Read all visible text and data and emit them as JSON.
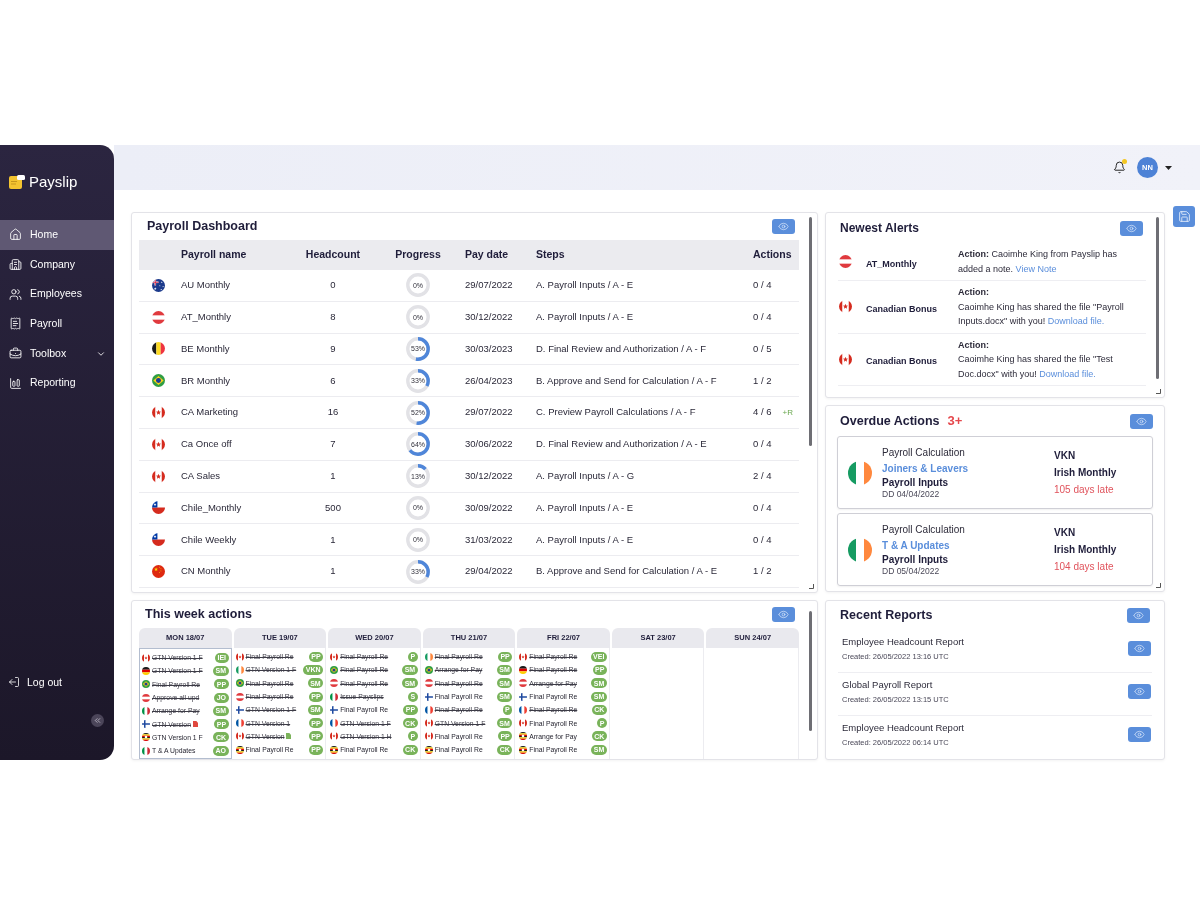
{
  "sidebar": {
    "logo": "Payslip",
    "items": [
      {
        "label": "Home",
        "selected": true,
        "kind": "link"
      },
      {
        "label": "Company",
        "selected": false,
        "kind": "link"
      },
      {
        "label": "Employees",
        "selected": false,
        "kind": "link"
      },
      {
        "label": "Payroll",
        "selected": false,
        "kind": "link"
      },
      {
        "label": "Toolbox",
        "selected": false,
        "kind": "group"
      },
      {
        "label": "Reporting",
        "selected": false,
        "kind": "link"
      }
    ],
    "logout": "Log out"
  },
  "header": {
    "notifications": {
      "unread": true
    },
    "user": {
      "initials": "NN"
    }
  },
  "payroll_dashboard": {
    "title": "Payroll Dashboard",
    "columns": [
      "Payroll name",
      "Headcount",
      "Progress",
      "Pay date",
      "Steps",
      "Actions"
    ],
    "rows": [
      {
        "flag": {
          "kind": "au"
        },
        "name": "AU Monthly",
        "headcount": "0",
        "progress": {
          "level": 0,
          "reading": "0%"
        },
        "pay_date": "29/07/2022",
        "steps": "A. Payroll Inputs / A - E",
        "actions": "0 / 4"
      },
      {
        "flag": {
          "kind": "at"
        },
        "name": "AT_Monthly",
        "headcount": "8",
        "progress": {
          "level": 0,
          "reading": "0%"
        },
        "pay_date": "30/12/2022",
        "steps": "A. Payroll Inputs / A - E",
        "actions": "0 / 4"
      },
      {
        "flag": {
          "kind": "be"
        },
        "name": "BE Monthly",
        "headcount": "9",
        "progress": {
          "level": 0.53,
          "reading": "53%"
        },
        "pay_date": "30/03/2023",
        "steps": "D. Final Review and Authorization / A - F",
        "actions": "0 / 5"
      },
      {
        "flag": {
          "kind": "br"
        },
        "name": "BR Monthly",
        "headcount": "6",
        "progress": {
          "level": 0.33,
          "reading": "33%"
        },
        "pay_date": "26/04/2023",
        "steps": "B. Approve and Send for Calculation / A - F",
        "actions": "1 / 2"
      },
      {
        "flag": {
          "kind": "ca"
        },
        "name": "CA Marketing",
        "headcount": "16",
        "progress": {
          "level": 0.52,
          "reading": "52%"
        },
        "pay_date": "29/07/2022",
        "steps": "C. Preview Payroll Calculations / A - F",
        "actions": "4 / 6",
        "note": "+R"
      },
      {
        "flag": {
          "kind": "ca"
        },
        "name": "Ca Once off",
        "headcount": "7",
        "progress": {
          "level": 0.64,
          "reading": "64%"
        },
        "pay_date": "30/06/2022",
        "steps": "D. Final Review and Authorization / A - E",
        "actions": "0 / 4"
      },
      {
        "flag": {
          "kind": "ca"
        },
        "name": "CA Sales",
        "headcount": "1",
        "progress": {
          "level": 0.13,
          "reading": "13%"
        },
        "pay_date": "30/12/2022",
        "steps": "A. Payroll Inputs / A - G",
        "actions": "2 / 4"
      },
      {
        "flag": {
          "kind": "cl"
        },
        "name": "Chile_Monthly",
        "headcount": "500",
        "progress": {
          "level": 0,
          "reading": "0%"
        },
        "pay_date": "30/09/2022",
        "steps": "A. Payroll Inputs / A - E",
        "actions": "0 / 4"
      },
      {
        "flag": {
          "kind": "cl"
        },
        "name": "Chile Weekly",
        "headcount": "1",
        "progress": {
          "level": 0,
          "reading": "0%"
        },
        "pay_date": "31/03/2022",
        "steps": "A. Payroll Inputs / A - E",
        "actions": "0 / 4"
      },
      {
        "flag": {
          "kind": "cn"
        },
        "name": "CN Monthly",
        "headcount": "1",
        "progress": {
          "level": 0.33,
          "reading": "33%"
        },
        "pay_date": "29/04/2022",
        "steps": "B. Approve and Send for Calculation / A - E",
        "actions": "1 / 2"
      }
    ]
  },
  "newest_alerts": {
    "title": "Newest Alerts",
    "items": [
      {
        "flag": {
          "kind": "at"
        },
        "name": "AT_Monthly",
        "kind": "note",
        "label": "Action:",
        "message": "Caoimhe King from Payslip has added a note.",
        "link": "View Note"
      },
      {
        "flag": {
          "kind": "ca"
        },
        "name": "Canadian Bonus",
        "kind": "file",
        "label": "Action:",
        "message": "Caoimhe King has shared the file \"Payroll Inputs.docx\" with you!",
        "link": "Download file."
      },
      {
        "flag": {
          "kind": "ca"
        },
        "name": "Canadian Bonus",
        "kind": "file",
        "label": "Action:",
        "message": "Caoimhe King has shared the file \"Test Doc.docx\" with you!",
        "link": "Download file."
      }
    ]
  },
  "overdue_actions": {
    "title": "Overdue Actions",
    "count": "3+",
    "items": [
      {
        "flag": {
          "kind": "ie"
        },
        "category": "Payroll Calculation",
        "task": "Joiners & Leavers",
        "step": "Payroll Inputs",
        "due": "DD 04/04/2022",
        "owner": "VKN",
        "payroll": "Irish Monthly",
        "late": "105 days late"
      },
      {
        "flag": {
          "kind": "ie"
        },
        "category": "Payroll Calculation",
        "task": "T & A Updates",
        "step": "Payroll Inputs",
        "due": "DD 05/04/2022",
        "owner": "VKN",
        "payroll": "Irish Monthly",
        "late": "104 days late"
      }
    ]
  },
  "this_week": {
    "title": "This week actions",
    "days": [
      {
        "label": "MON 18/07",
        "selected": true,
        "items": [
          {
            "flag": {
              "kind": "ca"
            },
            "text": "GTN Version 1 F",
            "done": true,
            "assignee": "IEI"
          },
          {
            "flag": {
              "kind": "de"
            },
            "text": "GTN Version 1 F",
            "done": true,
            "assignee": "SM"
          },
          {
            "flag": {
              "kind": "br"
            },
            "text": "Final Payroll Re",
            "done": true,
            "assignee": "PP"
          },
          {
            "flag": {
              "kind": "at"
            },
            "text": "Approve all upd",
            "done": true,
            "assignee": "JO"
          },
          {
            "flag": {
              "kind": "it"
            },
            "text": "Arrange for Pay",
            "done": true,
            "assignee": "SM"
          },
          {
            "flag": {
              "kind": "fi"
            },
            "text": "GTN Version",
            "done": true,
            "assignee": "PP",
            "marker": {
              "color": "#e0483e"
            }
          },
          {
            "flag": {
              "kind": "ug"
            },
            "text": "GTN Version 1 F",
            "done": false,
            "assignee": "CK"
          },
          {
            "flag": {
              "kind": "it"
            },
            "text": "T & A Updates",
            "done": false,
            "assignee": "AO"
          }
        ]
      },
      {
        "label": "TUE 19/07",
        "selected": false,
        "items": [
          {
            "flag": {
              "kind": "ca"
            },
            "text": "Final Payroll Re",
            "done": true,
            "assignee": "PP"
          },
          {
            "flag": {
              "kind": "ie"
            },
            "text": "GTN Version 1 F",
            "done": true,
            "assignee": "VKN"
          },
          {
            "flag": {
              "kind": "br"
            },
            "text": "Final Payroll Re",
            "done": true,
            "assignee": "SM"
          },
          {
            "flag": {
              "kind": "at"
            },
            "text": "Final Payroll Re",
            "done": true,
            "assignee": "PP"
          },
          {
            "flag": {
              "kind": "fi"
            },
            "text": "GTN Version 1 F",
            "done": true,
            "assignee": "SM"
          },
          {
            "flag": {
              "kind": "fr"
            },
            "text": "GTN Version 1",
            "done": true,
            "assignee": "PP"
          },
          {
            "flag": {
              "kind": "ca"
            },
            "text": "GTN Version",
            "done": true,
            "assignee": "PP",
            "marker": {
              "color": "#7cb35b"
            }
          },
          {
            "flag": {
              "kind": "ug"
            },
            "text": "Final Payroll Re",
            "done": false,
            "assignee": "PP"
          }
        ]
      },
      {
        "label": "WED 20/07",
        "selected": false,
        "items": [
          {
            "flag": {
              "kind": "ca"
            },
            "text": "Final Payroll Re",
            "done": true,
            "assignee": "P"
          },
          {
            "flag": {
              "kind": "br"
            },
            "text": "Final Payroll Re",
            "done": true,
            "assignee": "SM"
          },
          {
            "flag": {
              "kind": "at"
            },
            "text": "Final Payroll Re",
            "done": true,
            "assignee": "SM"
          },
          {
            "flag": {
              "kind": "it"
            },
            "text": "Issue Payslips",
            "done": true,
            "assignee": "S"
          },
          {
            "flag": {
              "kind": "fi"
            },
            "text": "Final Payroll Re",
            "done": false,
            "assignee": "PP"
          },
          {
            "flag": {
              "kind": "fr"
            },
            "text": "GTN Version 1 F",
            "done": true,
            "assignee": "CK"
          },
          {
            "flag": {
              "kind": "ca"
            },
            "text": "GTN Version 1 H",
            "done": true,
            "assignee": "P"
          },
          {
            "flag": {
              "kind": "ug"
            },
            "text": "Final Payroll Re",
            "done": false,
            "assignee": "CK"
          }
        ]
      },
      {
        "label": "THU 21/07",
        "selected": false,
        "items": [
          {
            "flag": {
              "kind": "ie"
            },
            "text": "Final Payroll Re",
            "done": true,
            "assignee": "PP"
          },
          {
            "flag": {
              "kind": "br"
            },
            "text": "Arrange for Pay",
            "done": true,
            "assignee": "SM"
          },
          {
            "flag": {
              "kind": "at"
            },
            "text": "Final Payroll Re",
            "done": true,
            "assignee": "SM"
          },
          {
            "flag": {
              "kind": "fi"
            },
            "text": "Final Payroll Re",
            "done": false,
            "assignee": "SM"
          },
          {
            "flag": {
              "kind": "fr"
            },
            "text": "Final Payroll Re",
            "done": true,
            "assignee": "P"
          },
          {
            "flag": {
              "kind": "ca"
            },
            "text": "GTN Version 1 F",
            "done": true,
            "assignee": "SM"
          },
          {
            "flag": {
              "kind": "ca"
            },
            "text": "Final Payroll Re",
            "done": false,
            "assignee": "PP"
          },
          {
            "flag": {
              "kind": "ug"
            },
            "text": "Final Payroll Re",
            "done": false,
            "assignee": "CK"
          }
        ]
      },
      {
        "label": "FRI 22/07",
        "selected": false,
        "items": [
          {
            "flag": {
              "kind": "ca"
            },
            "text": "Final Payroll Re",
            "done": true,
            "assignee": "VEI"
          },
          {
            "flag": {
              "kind": "de"
            },
            "text": "Final Payroll Re",
            "done": true,
            "assignee": "PP"
          },
          {
            "flag": {
              "kind": "at"
            },
            "text": "Arrange for Pay",
            "done": true,
            "assignee": "SM"
          },
          {
            "flag": {
              "kind": "fi"
            },
            "text": "Final Payroll Re",
            "done": false,
            "assignee": "SM"
          },
          {
            "flag": {
              "kind": "fr"
            },
            "text": "Final Payroll Re",
            "done": true,
            "assignee": "CK"
          },
          {
            "flag": {
              "kind": "ca"
            },
            "text": "Final Payroll Re",
            "done": false,
            "assignee": "P"
          },
          {
            "flag": {
              "kind": "ug"
            },
            "text": "Arrange for Pay",
            "done": false,
            "assignee": "CK"
          },
          {
            "flag": {
              "kind": "ug"
            },
            "text": "Final Payroll Re",
            "done": false,
            "assignee": "SM"
          }
        ]
      },
      {
        "label": "SAT 23/07",
        "selected": false
      },
      {
        "label": "SUN 24/07",
        "selected": false
      }
    ]
  },
  "recent_reports": {
    "title": "Recent Reports",
    "items": [
      {
        "name": "Employee Headcount Report",
        "created": "Created: 26/05/2022 13:16 UTC"
      },
      {
        "name": "Global Payroll Report",
        "created": "Created: 26/05/2022 13:15 UTC"
      },
      {
        "name": "Employee Headcount Report",
        "created": "Created: 26/05/2022 06:14 UTC"
      }
    ]
  }
}
